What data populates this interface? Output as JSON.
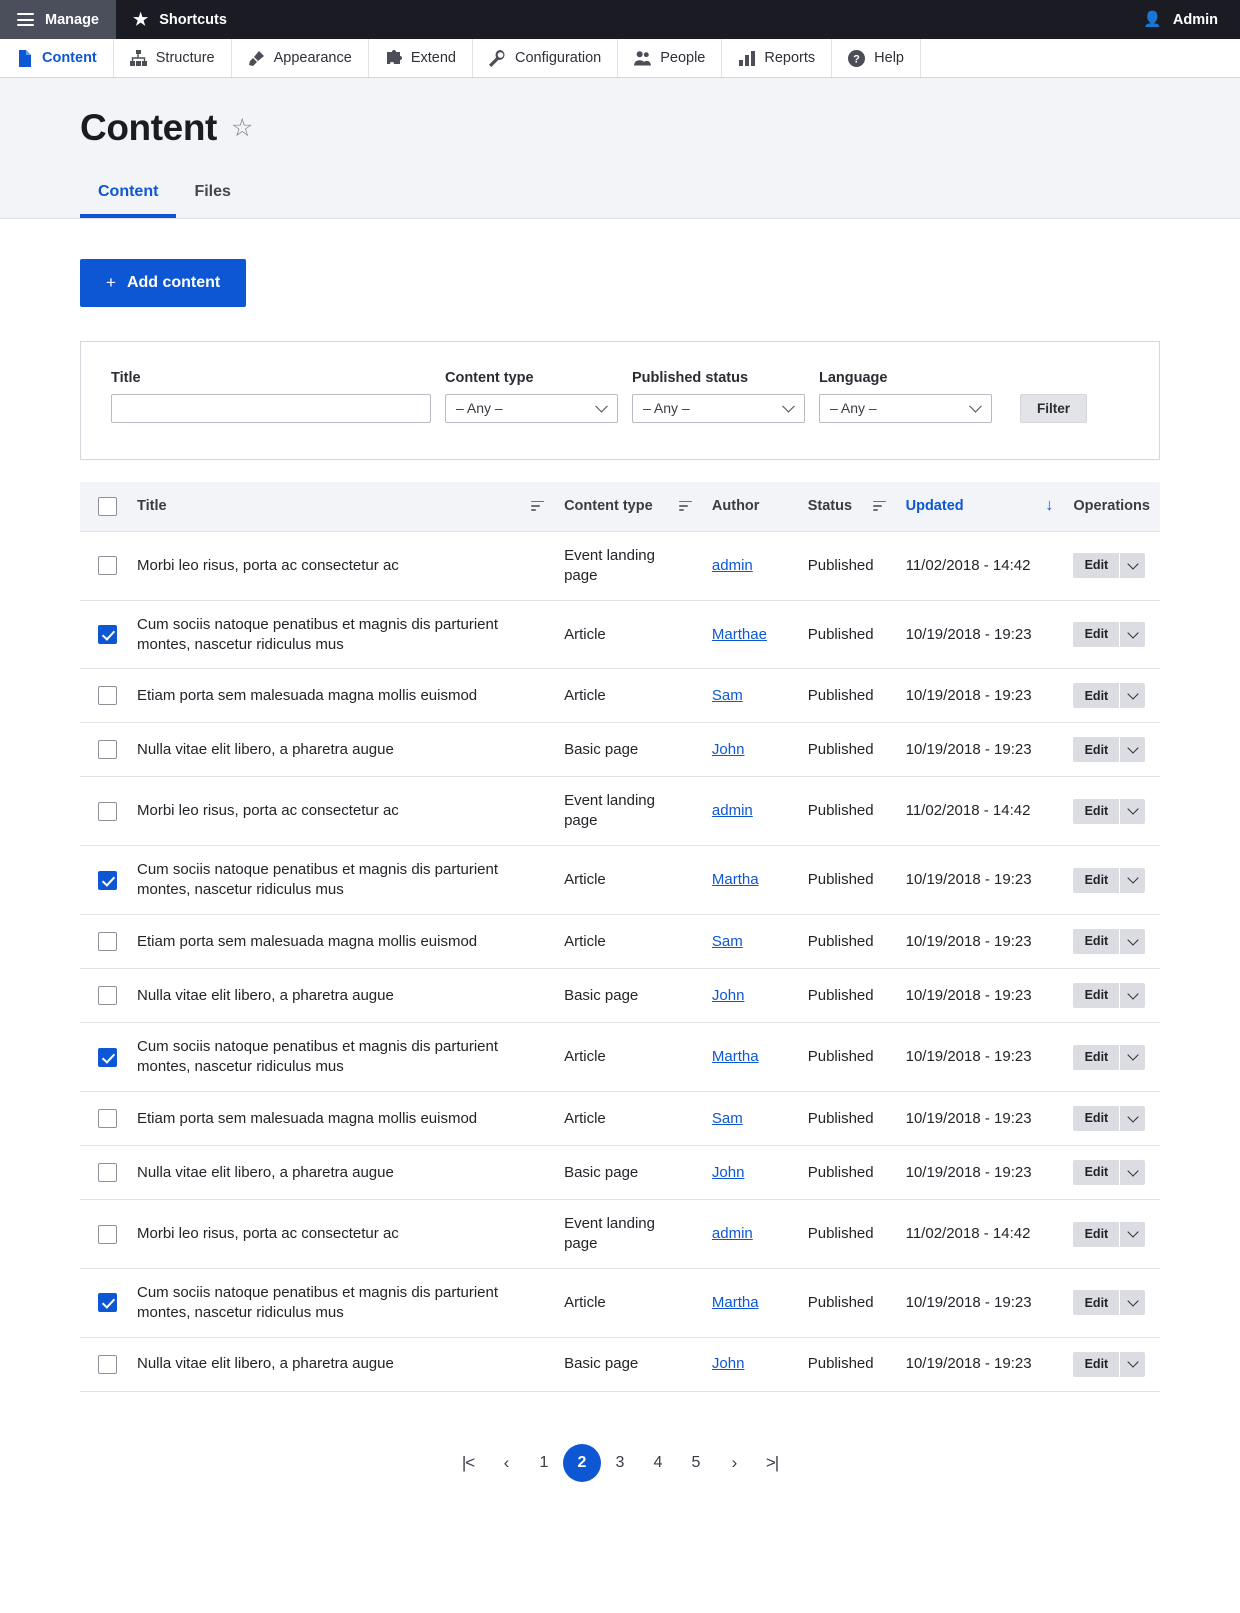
{
  "toolbar": {
    "manage_label": "Manage",
    "shortcuts_label": "Shortcuts",
    "user_label": "Admin",
    "menu_icon": "hamburger-icon",
    "star_icon": "star-filled-icon",
    "person_icon": "person-icon"
  },
  "nav": {
    "items": [
      {
        "label": "Content",
        "icon": "document-icon",
        "active": true
      },
      {
        "label": "Structure",
        "icon": "sitemap-icon",
        "active": false
      },
      {
        "label": "Appearance",
        "icon": "paintbrush-icon",
        "active": false
      },
      {
        "label": "Extend",
        "icon": "puzzle-icon",
        "active": false
      },
      {
        "label": "Configuration",
        "icon": "wrench-icon",
        "active": false
      },
      {
        "label": "People",
        "icon": "people-icon",
        "active": false
      },
      {
        "label": "Reports",
        "icon": "bar-chart-icon",
        "active": false
      },
      {
        "label": "Help",
        "icon": "question-icon",
        "active": false
      }
    ]
  },
  "page": {
    "title": "Content",
    "star_icon": "star-outline-icon",
    "tabs": [
      {
        "label": "Content",
        "active": true
      },
      {
        "label": "Files",
        "active": false
      }
    ]
  },
  "actions": {
    "add_content_label": "Add content",
    "add_content_plus": "+"
  },
  "filters": {
    "title": {
      "label": "Title",
      "value": "",
      "placeholder": ""
    },
    "content_type": {
      "label": "Content type",
      "value": "– Any –"
    },
    "published_status": {
      "label": "Published status",
      "value": "– Any –"
    },
    "language": {
      "label": "Language",
      "value": "– Any –"
    },
    "filter_button": "Filter"
  },
  "table": {
    "columns": {
      "title": "Title",
      "content_type": "Content type",
      "author": "Author",
      "status": "Status",
      "updated": "Updated",
      "operations": "Operations"
    },
    "sort": {
      "column": "Updated",
      "direction": "desc",
      "arrow": "↓"
    },
    "select_all_checked": false,
    "row_op_edit": "Edit",
    "rows": [
      {
        "checked": false,
        "title": "Morbi leo risus, porta ac consectetur ac",
        "type": "Event landing page",
        "author": "admin",
        "status": "Published",
        "updated": "11/02/2018 - 14:42"
      },
      {
        "checked": true,
        "title": "Cum sociis natoque penatibus et magnis dis parturient montes, nascetur ridiculus mus",
        "type": "Article",
        "author": "Marthae",
        "status": "Published",
        "updated": "10/19/2018 - 19:23"
      },
      {
        "checked": false,
        "title": "Etiam porta sem malesuada magna mollis euismod",
        "type": "Article",
        "author": "Sam",
        "status": "Published",
        "updated": "10/19/2018 - 19:23"
      },
      {
        "checked": false,
        "title": "Nulla vitae elit libero, a pharetra augue",
        "type": "Basic page",
        "author": "John",
        "status": "Published",
        "updated": "10/19/2018 - 19:23"
      },
      {
        "checked": false,
        "title": "Morbi leo risus, porta ac consectetur ac",
        "type": "Event landing page",
        "author": "admin",
        "status": "Published",
        "updated": "11/02/2018 - 14:42"
      },
      {
        "checked": true,
        "title": "Cum sociis natoque penatibus et magnis dis parturient montes, nascetur ridiculus mus",
        "type": "Article",
        "author": "Martha",
        "status": "Published",
        "updated": "10/19/2018 - 19:23"
      },
      {
        "checked": false,
        "title": "Etiam porta sem malesuada magna mollis euismod",
        "type": "Article",
        "author": "Sam",
        "status": "Published",
        "updated": "10/19/2018 - 19:23"
      },
      {
        "checked": false,
        "title": "Nulla vitae elit libero, a pharetra augue",
        "type": "Basic page",
        "author": "John",
        "status": "Published",
        "updated": "10/19/2018 - 19:23"
      },
      {
        "checked": true,
        "title": "Cum sociis natoque penatibus et magnis dis parturient montes, nascetur ridiculus mus",
        "type": "Article",
        "author": "Martha",
        "status": "Published",
        "updated": "10/19/2018 - 19:23"
      },
      {
        "checked": false,
        "title": "Etiam porta sem malesuada magna mollis euismod",
        "type": "Article",
        "author": "Sam",
        "status": "Published",
        "updated": "10/19/2018 - 19:23"
      },
      {
        "checked": false,
        "title": "Nulla vitae elit libero, a pharetra augue",
        "type": "Basic page",
        "author": "John",
        "status": "Published",
        "updated": "10/19/2018 - 19:23"
      },
      {
        "checked": false,
        "title": "Morbi leo risus, porta ac consectetur ac",
        "type": "Event landing page",
        "author": "admin",
        "status": "Published",
        "updated": "11/02/2018 - 14:42"
      },
      {
        "checked": true,
        "title": "Cum sociis natoque penatibus et magnis dis parturient montes, nascetur ridiculus mus",
        "type": "Article",
        "author": "Martha",
        "status": "Published",
        "updated": "10/19/2018 - 19:23"
      },
      {
        "checked": false,
        "title": "Nulla vitae elit libero, a pharetra augue",
        "type": "Basic page",
        "author": "John",
        "status": "Published",
        "updated": "10/19/2018 - 19:23"
      }
    ]
  },
  "pager": {
    "first": "|<",
    "prev": "‹",
    "pages": [
      "1",
      "2",
      "3",
      "4",
      "5"
    ],
    "current": "2",
    "next": "›",
    "last": ">|"
  },
  "colors": {
    "accent": "#0d57d4",
    "toolbar_bg": "#1b1b23",
    "manage_bg": "#4b4f5c",
    "header_bg": "#f2f4f7"
  }
}
